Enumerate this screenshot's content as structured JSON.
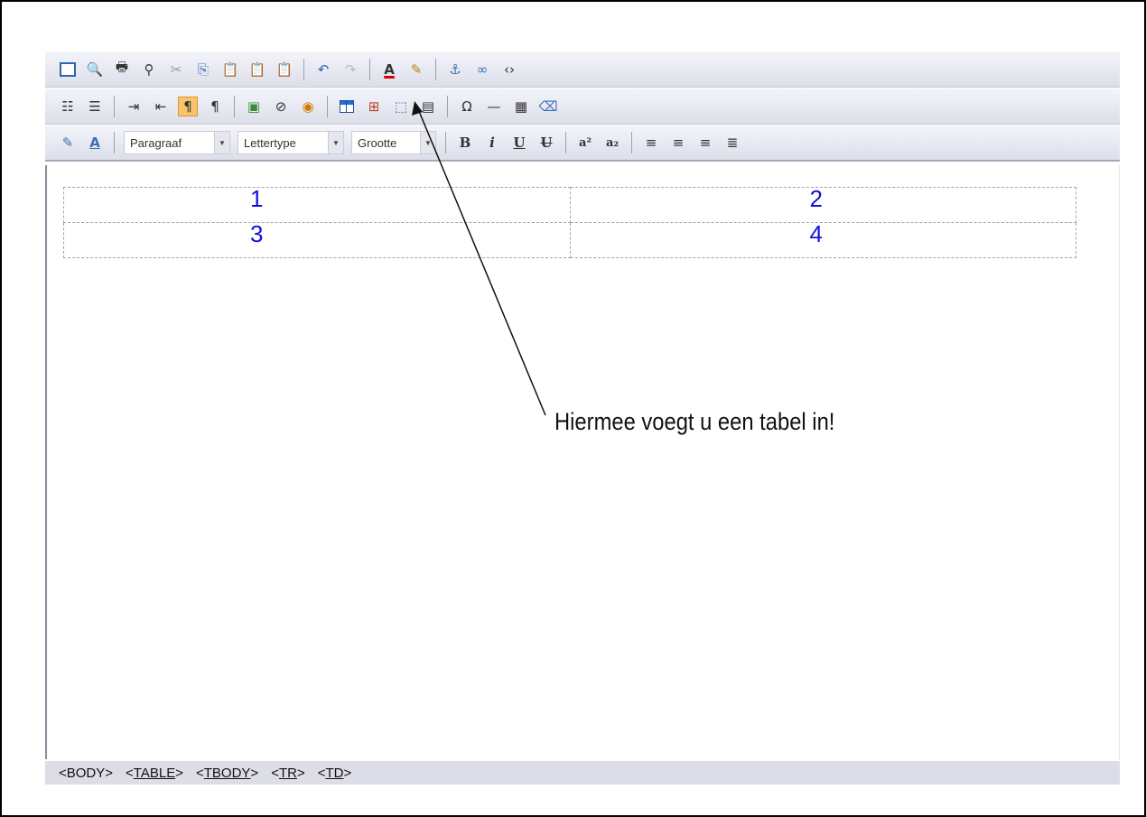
{
  "toolbar": {
    "format_dropdown": "Paragraaf",
    "font_dropdown": "Lettertype",
    "size_dropdown": "Grootte",
    "bold": "B",
    "italic": "i",
    "underline": "U",
    "strike": "U",
    "superscript": "a²",
    "subscript": "a₂"
  },
  "table": {
    "rows": [
      [
        "1",
        "2"
      ],
      [
        "3",
        "4"
      ]
    ]
  },
  "annotation": "Hiermee voegt u een tabel in!",
  "statusbar": {
    "body": "<BODY>",
    "table": "TABLE",
    "tbody": "TBODY",
    "tr": "TR",
    "td": "TD"
  }
}
